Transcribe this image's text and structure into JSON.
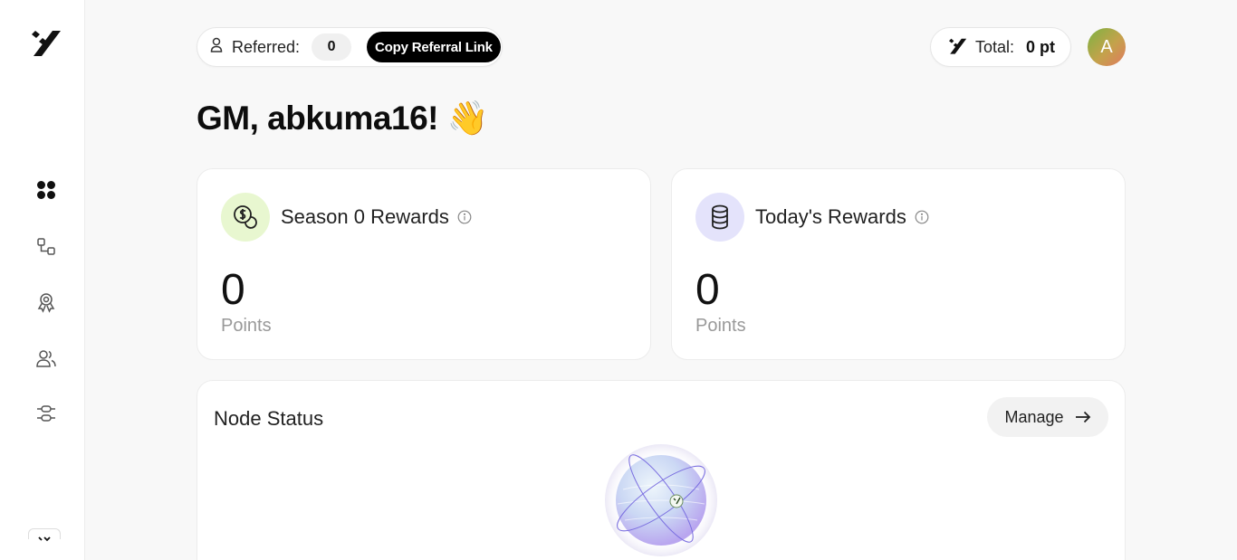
{
  "sidebar": {
    "logo": "brand-logo",
    "nav": [
      {
        "icon": "dashboard-icon"
      },
      {
        "icon": "nodes-icon"
      },
      {
        "icon": "rewards-badge-icon"
      },
      {
        "icon": "users-icon"
      },
      {
        "icon": "settings-sliders-icon"
      }
    ]
  },
  "header": {
    "referred_label": "Referred:",
    "referred_count": "0",
    "copy_referral_label": "Copy Referral Link",
    "total_label": "Total:",
    "total_value": "0 pt",
    "avatar_initial": "A"
  },
  "greeting": "GM, abkuma16! 👋",
  "cards": {
    "season": {
      "title": "Season 0 Rewards",
      "value": "0",
      "unit": "Points",
      "icon": "coin-dollar-icon",
      "icon_bg": "#e8f7d0"
    },
    "today": {
      "title": "Today's Rewards",
      "value": "0",
      "unit": "Points",
      "icon": "coin-stack-icon",
      "icon_bg": "#e4e3fb"
    }
  },
  "node": {
    "title": "Node Status",
    "manage_label": "Manage"
  },
  "colors": {
    "accent_black": "#000000",
    "muted_text": "#999999",
    "background": "#f8f8f8"
  }
}
